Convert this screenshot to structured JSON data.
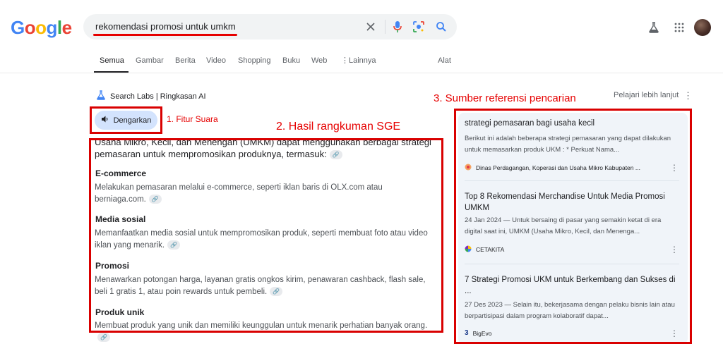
{
  "logo": {
    "text": "Google",
    "letters": [
      "G",
      "o",
      "o",
      "g",
      "l",
      "e"
    ],
    "colors": [
      "#4285f4",
      "#ea4335",
      "#fbbc05",
      "#4285f4",
      "#34a853",
      "#ea4335"
    ]
  },
  "search": {
    "query": "rekomendasi promosi untuk umkm",
    "icons": [
      "close-icon",
      "mic-icon",
      "lens-icon",
      "search-icon"
    ]
  },
  "header": {
    "icons": [
      "labs-flask-icon",
      "apps-grid-icon"
    ]
  },
  "tabs": [
    "Semua",
    "Gambar",
    "Berita",
    "Video",
    "Shopping",
    "Buku",
    "Web",
    "Lainnya",
    "Alat"
  ],
  "sge": {
    "label": "Search Labs | Ringkasan AI",
    "learn_more": "Pelajari lebih lanjut",
    "listen_label": "Dengarkan",
    "intro": "Usaha Mikro, Kecil, dan Menengah (UMKM) dapat menggunakan berbagai strategi pemasaran untuk mempromosikan produknya, termasuk:",
    "sections": [
      {
        "heading": "E-commerce",
        "text": "Melakukan pemasaran melalui e-commerce, seperti iklan baris di OLX.com atau berniaga.com."
      },
      {
        "heading": "Media sosial",
        "text": "Memanfaatkan media sosial untuk mempromosikan produk, seperti membuat foto atau video iklan yang menarik."
      },
      {
        "heading": "Promosi",
        "text": "Menawarkan potongan harga, layanan gratis ongkos kirim, penawaran cashback, flash sale, beli 1 gratis 1, atau poin rewards untuk pembeli."
      },
      {
        "heading": "Produk unik",
        "text": "Membuat produk yang unik dan memiliki keunggulan untuk menarik perhatian banyak orang."
      }
    ]
  },
  "annotations": {
    "note1": "1. Fitur Suara",
    "note2": "2. Hasil rangkuman SGE",
    "note3": "3. Sumber referensi pencarian",
    "color": "#e60000"
  },
  "sources": [
    {
      "title": "strategi pemasaran bagi usaha kecil",
      "snippet": "Berikut ini adalah beberapa strategi pemasaran yang dapat dilakukan untuk memasarkan produk UKM : * Perkuat Nama...",
      "site": "Dinas Perdagangan, Koperasi dan Usaha Mikro Kabupaten ..."
    },
    {
      "title": "Top 8 Rekomendasi Merchandise Untuk Media Promosi UMKM",
      "snippet": "24 Jan 2024 — Untuk bersaing di pasar yang semakin ketat di era digital saat ini, UMKM (Usaha Mikro, Kecil, dan Menenga...",
      "site": "CETAKITA"
    },
    {
      "title": "7 Strategi Promosi UKM untuk Berkembang dan Sukses di ...",
      "snippet": "27 Des 2023 — Selain itu, bekerjasama dengan pelaku bisnis lain atau berpartisipasi dalam program kolaboratif dapat...",
      "site": "BigEvo"
    }
  ]
}
